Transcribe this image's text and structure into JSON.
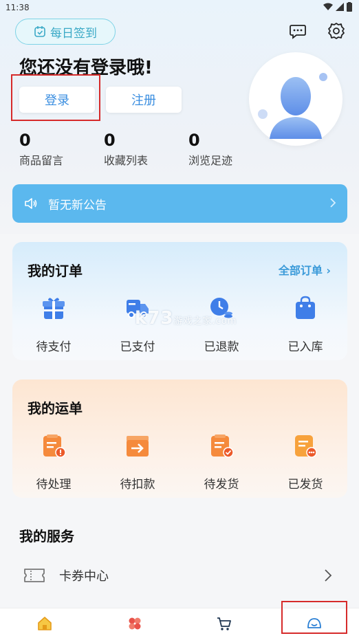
{
  "status_bar": {
    "time": "11:38"
  },
  "header": {
    "checkin_label": "每日签到",
    "login_prompt": "您还没有登录哦!",
    "login_label": "登录",
    "register_label": "注册"
  },
  "stats": [
    {
      "value": "0",
      "label": "商品留言"
    },
    {
      "value": "0",
      "label": "收藏列表"
    },
    {
      "value": "0",
      "label": "浏览足迹"
    }
  ],
  "notice": {
    "text": "暂无新公告"
  },
  "orders": {
    "title": "我的订单",
    "all_link": "全部订单",
    "items": [
      {
        "label": "待支付",
        "icon": "gift-box-icon"
      },
      {
        "label": "已支付",
        "icon": "delivery-truck-icon"
      },
      {
        "label": "已退款",
        "icon": "refund-clock-icon"
      },
      {
        "label": "已入库",
        "icon": "shopping-bag-icon"
      }
    ]
  },
  "waybills": {
    "title": "我的运单",
    "items": [
      {
        "label": "待处理",
        "icon": "clipboard-alert-icon"
      },
      {
        "label": "待扣款",
        "icon": "arrow-box-icon"
      },
      {
        "label": "待发货",
        "icon": "clipboard-check-icon"
      },
      {
        "label": "已发货",
        "icon": "clipboard-more-icon"
      }
    ]
  },
  "services": {
    "title": "我的服务",
    "items": [
      {
        "label": "卡券中心",
        "icon": "ticket-icon"
      }
    ]
  },
  "watermark": {
    "main": "k73",
    "sub": "游戏之家",
    "domain": ".com"
  },
  "colors": {
    "accent_blue": "#3a9ad9",
    "notice_bg": "#5bb8ee",
    "order_icon_blue": "#3f7ee8",
    "waybill_icon_orange": "#f58a3c",
    "highlight_red": "#d62a2a"
  }
}
